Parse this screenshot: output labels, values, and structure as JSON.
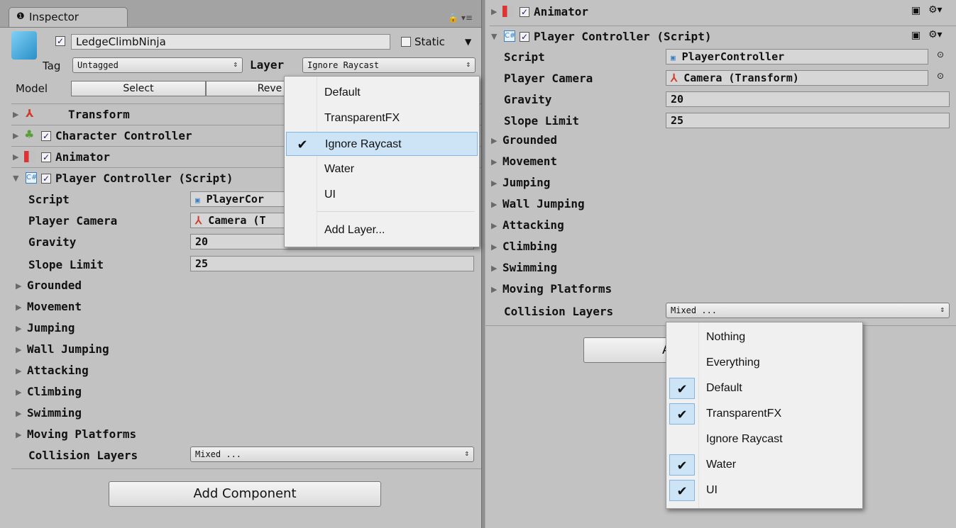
{
  "inspector": {
    "tab_label": "Inspector",
    "object_name": "LedgeClimbNinja",
    "static_label": "Static",
    "tag_label": "Tag",
    "tag_value": "Untagged",
    "layer_label": "Layer",
    "layer_value": "Ignore Raycast",
    "model_label": "Model",
    "model_select": "Select",
    "model_revert": "Reve"
  },
  "components": {
    "transform": "Transform",
    "character_controller": "Character Controller",
    "animator": "Animator",
    "player_controller": "Player Controller (Script)"
  },
  "fields": {
    "script_label": "Script",
    "script_value_left": "PlayerCor",
    "script_value_right": "PlayerController",
    "camera_label": "Player Camera",
    "camera_value_left": "Camera (T",
    "camera_value_right": "Camera (Transform)",
    "gravity_label": "Gravity",
    "gravity_value": "20",
    "slope_label": "Slope Limit",
    "slope_value": "25"
  },
  "foldouts": [
    "Grounded",
    "Movement",
    "Jumping",
    "Wall Jumping",
    "Attacking",
    "Climbing",
    "Swimming",
    "Moving Platforms"
  ],
  "collision": {
    "label": "Collision Layers",
    "value": "Mixed ..."
  },
  "add_component": "Add Component",
  "add_component_partial": "A",
  "layer_dropdown": {
    "items": [
      {
        "label": "Default",
        "checked": false
      },
      {
        "label": "TransparentFX",
        "checked": false
      },
      {
        "label": "Ignore Raycast",
        "checked": true
      },
      {
        "label": "Water",
        "checked": false
      },
      {
        "label": "UI",
        "checked": false
      }
    ],
    "add_layer": "Add Layer..."
  },
  "mask_dropdown": {
    "items": [
      {
        "label": "Nothing",
        "checked": false
      },
      {
        "label": "Everything",
        "checked": false
      },
      {
        "label": "Default",
        "checked": true
      },
      {
        "label": "TransparentFX",
        "checked": true
      },
      {
        "label": "Ignore Raycast",
        "checked": false
      },
      {
        "label": "Water",
        "checked": true
      },
      {
        "label": "UI",
        "checked": true
      }
    ]
  }
}
